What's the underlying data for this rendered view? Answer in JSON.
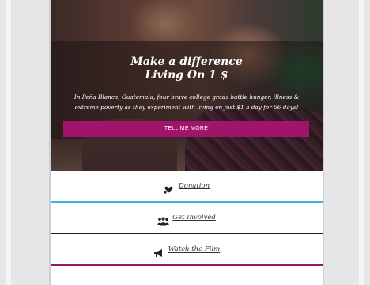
{
  "hero": {
    "title_line1": "Make a difference",
    "title_line2": "Living On 1 $",
    "body": "In Peña Blanca, Guatemala, four brave college grads battle hunger, illness & extreme poverty as they experiment with living on just $1 a day for 56 days!",
    "cta_label": "TELL ME MORE"
  },
  "menu": {
    "items": [
      {
        "label": "Donation",
        "icon": "heart-hand-icon"
      },
      {
        "label": "Get Involved",
        "icon": "people-group-icon"
      },
      {
        "label": "Watch the Film",
        "icon": "megaphone-icon"
      }
    ]
  },
  "colors": {
    "cta": "#a0146b",
    "separator_1": "#3bb3d6",
    "separator_2": "#222222",
    "separator_3": "#8e1a60"
  }
}
